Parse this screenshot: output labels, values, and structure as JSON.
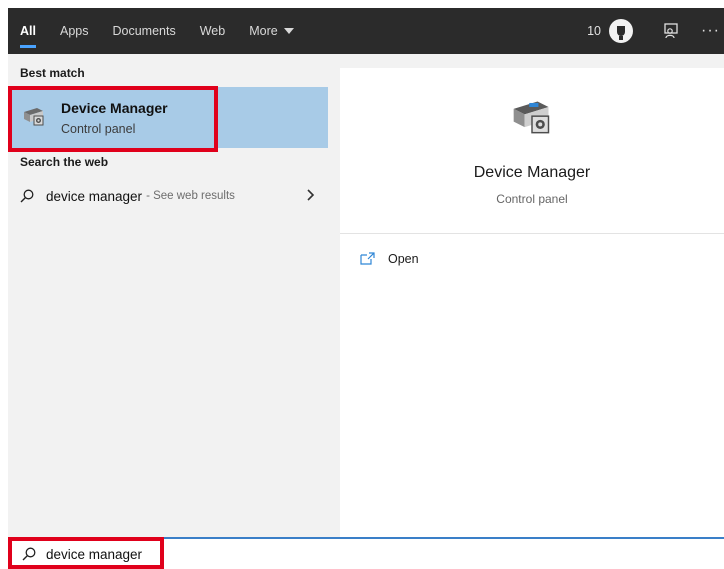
{
  "tabs": [
    {
      "label": "All",
      "active": true
    },
    {
      "label": "Apps"
    },
    {
      "label": "Documents"
    },
    {
      "label": "Web"
    },
    {
      "label": "More"
    }
  ],
  "header": {
    "points": "10",
    "reward_icon": "trophy-icon",
    "feedback_icon": "feedback-icon",
    "more_icon": "ellipsis-icon",
    "more_glyph": "···"
  },
  "best_match": {
    "section_title": "Best match",
    "title": "Device Manager",
    "subtitle": "Control panel",
    "icon": "device-manager-icon"
  },
  "web": {
    "section_title": "Search the web",
    "query": "device manager",
    "suffix": "- See web results"
  },
  "detail": {
    "title": "Device Manager",
    "subtitle": "Control panel",
    "actions": [
      {
        "label": "Open",
        "icon": "open-icon"
      }
    ]
  },
  "search": {
    "value": "device manager"
  },
  "colors": {
    "accent": "#4aa3ff",
    "highlight_border": "#e0001b",
    "selected_bg": "#a8cbe7",
    "tabbar_bg": "#2b2b2b"
  }
}
